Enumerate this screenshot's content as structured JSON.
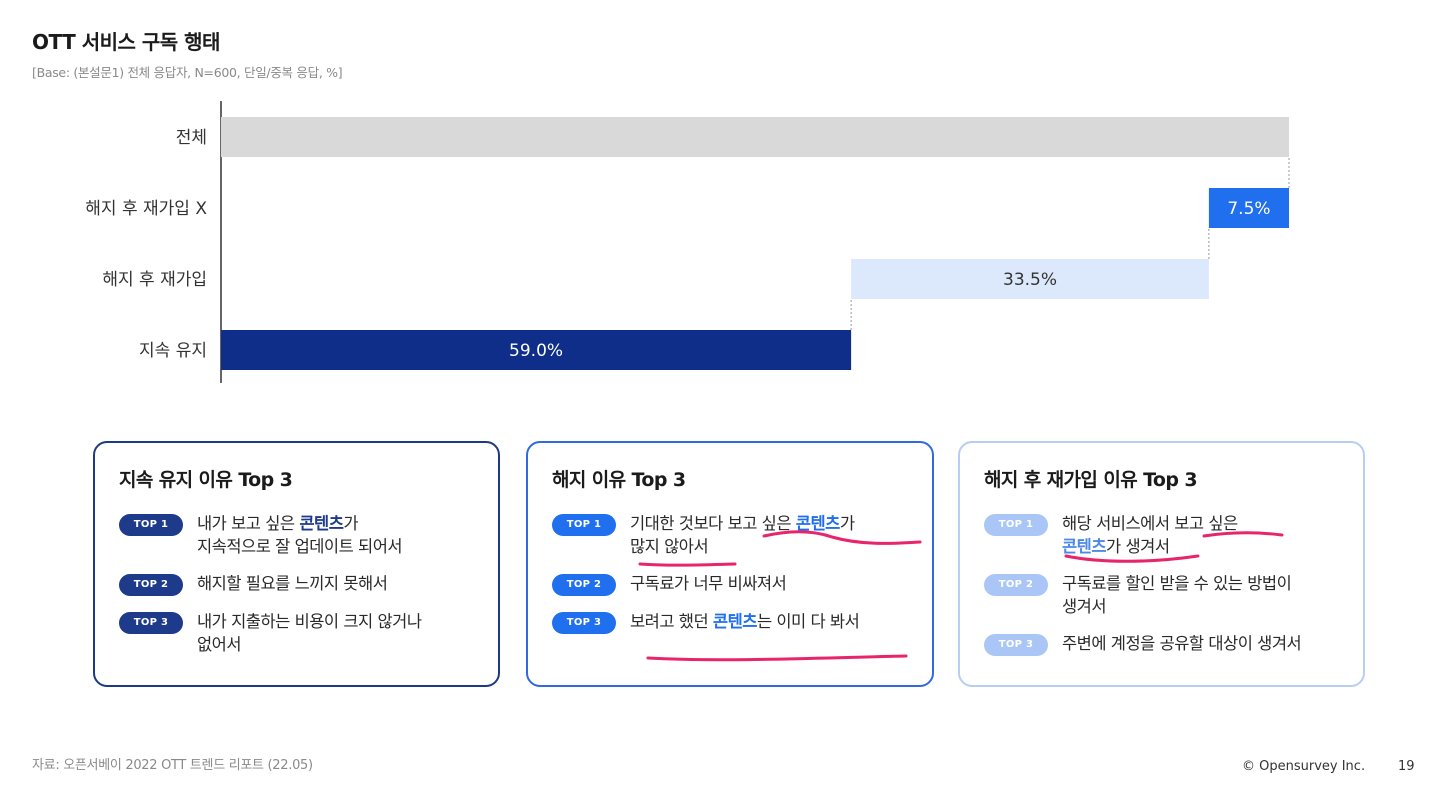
{
  "header": {
    "title": "OTT 서비스 구독 행태",
    "subtitle": "[Base: (본설문1) 전체 응답자, N=600, 단일/중복 응답, %]"
  },
  "chart_data": {
    "type": "bar",
    "orientation": "horizontal-waterfall",
    "categories": [
      "전체",
      "해지 후 재가입 X",
      "해지 후 재가입",
      "지속 유지"
    ],
    "values": [
      100,
      7.5,
      33.5,
      59.0
    ],
    "value_labels": [
      "",
      "7.5%",
      "33.5%",
      "59.0%"
    ],
    "colors": [
      "#d9d9d9",
      "#1f6fee",
      "#dce8fb",
      "#0f2e8a"
    ],
    "label_colors": [
      "#333333",
      "#ffffff",
      "#333333",
      "#ffffff"
    ],
    "xlim": [
      0,
      100
    ],
    "grid": false,
    "legend": "none"
  },
  "cards": [
    {
      "title": "지속 유지 이유 Top 3",
      "items": [
        {
          "badge": "TOP 1",
          "segments": [
            {
              "t": "내가 보고 싶은 "
            },
            {
              "t": "콘텐츠",
              "kw": true
            },
            {
              "t": "가"
            },
            {
              "br": true
            },
            {
              "t": "지속적으로 잘 업데이트 되어서"
            }
          ]
        },
        {
          "badge": "TOP 2",
          "segments": [
            {
              "t": "해지할 필요를 느끼지 못해서"
            }
          ]
        },
        {
          "badge": "TOP 3",
          "segments": [
            {
              "t": "내가 지출하는 비용이 크지 않거나"
            },
            {
              "br": true
            },
            {
              "t": "없어서"
            }
          ]
        }
      ]
    },
    {
      "title": "해지 이유 Top 3",
      "items": [
        {
          "badge": "TOP 1",
          "segments": [
            {
              "t": "기대한 것보다 보고 싶은 "
            },
            {
              "t": "콘텐츠",
              "kw": true
            },
            {
              "t": "가"
            },
            {
              "br": true
            },
            {
              "t": "많지 않아서"
            }
          ]
        },
        {
          "badge": "TOP 2",
          "segments": [
            {
              "t": "구독료가 너무 비싸져서"
            }
          ]
        },
        {
          "badge": "TOP 3",
          "segments": [
            {
              "t": "보려고 했던 "
            },
            {
              "t": "콘텐츠",
              "kw": true
            },
            {
              "t": "는 이미 다 봐서"
            }
          ]
        }
      ]
    },
    {
      "title": "해지 후 재가입 이유 Top 3",
      "items": [
        {
          "badge": "TOP 1",
          "segments": [
            {
              "t": "해당 서비스에서 보고 싶은"
            },
            {
              "br": true
            },
            {
              "t": "콘텐츠",
              "kw": true
            },
            {
              "t": "가 생겨서"
            }
          ]
        },
        {
          "badge": "TOP 2",
          "segments": [
            {
              "t": "구독료를 할인 받을 수 있는 방법이"
            },
            {
              "br": true
            },
            {
              "t": "생겨서"
            }
          ]
        },
        {
          "badge": "TOP 3",
          "segments": [
            {
              "t": "주변에 계정을 공유할 대상이 생겨서"
            }
          ]
        }
      ]
    }
  ],
  "footer": {
    "source": "자료: 오픈서베이 2022 OTT 트렌드 리포트 (22.05)",
    "copyright": "© Opensurvey Inc.",
    "page": "19"
  },
  "accent_colors": {
    "underline": "#e8246a",
    "navy": "#0f2e8a",
    "blue": "#1f6fee",
    "light_blue": "#dce8fb"
  }
}
